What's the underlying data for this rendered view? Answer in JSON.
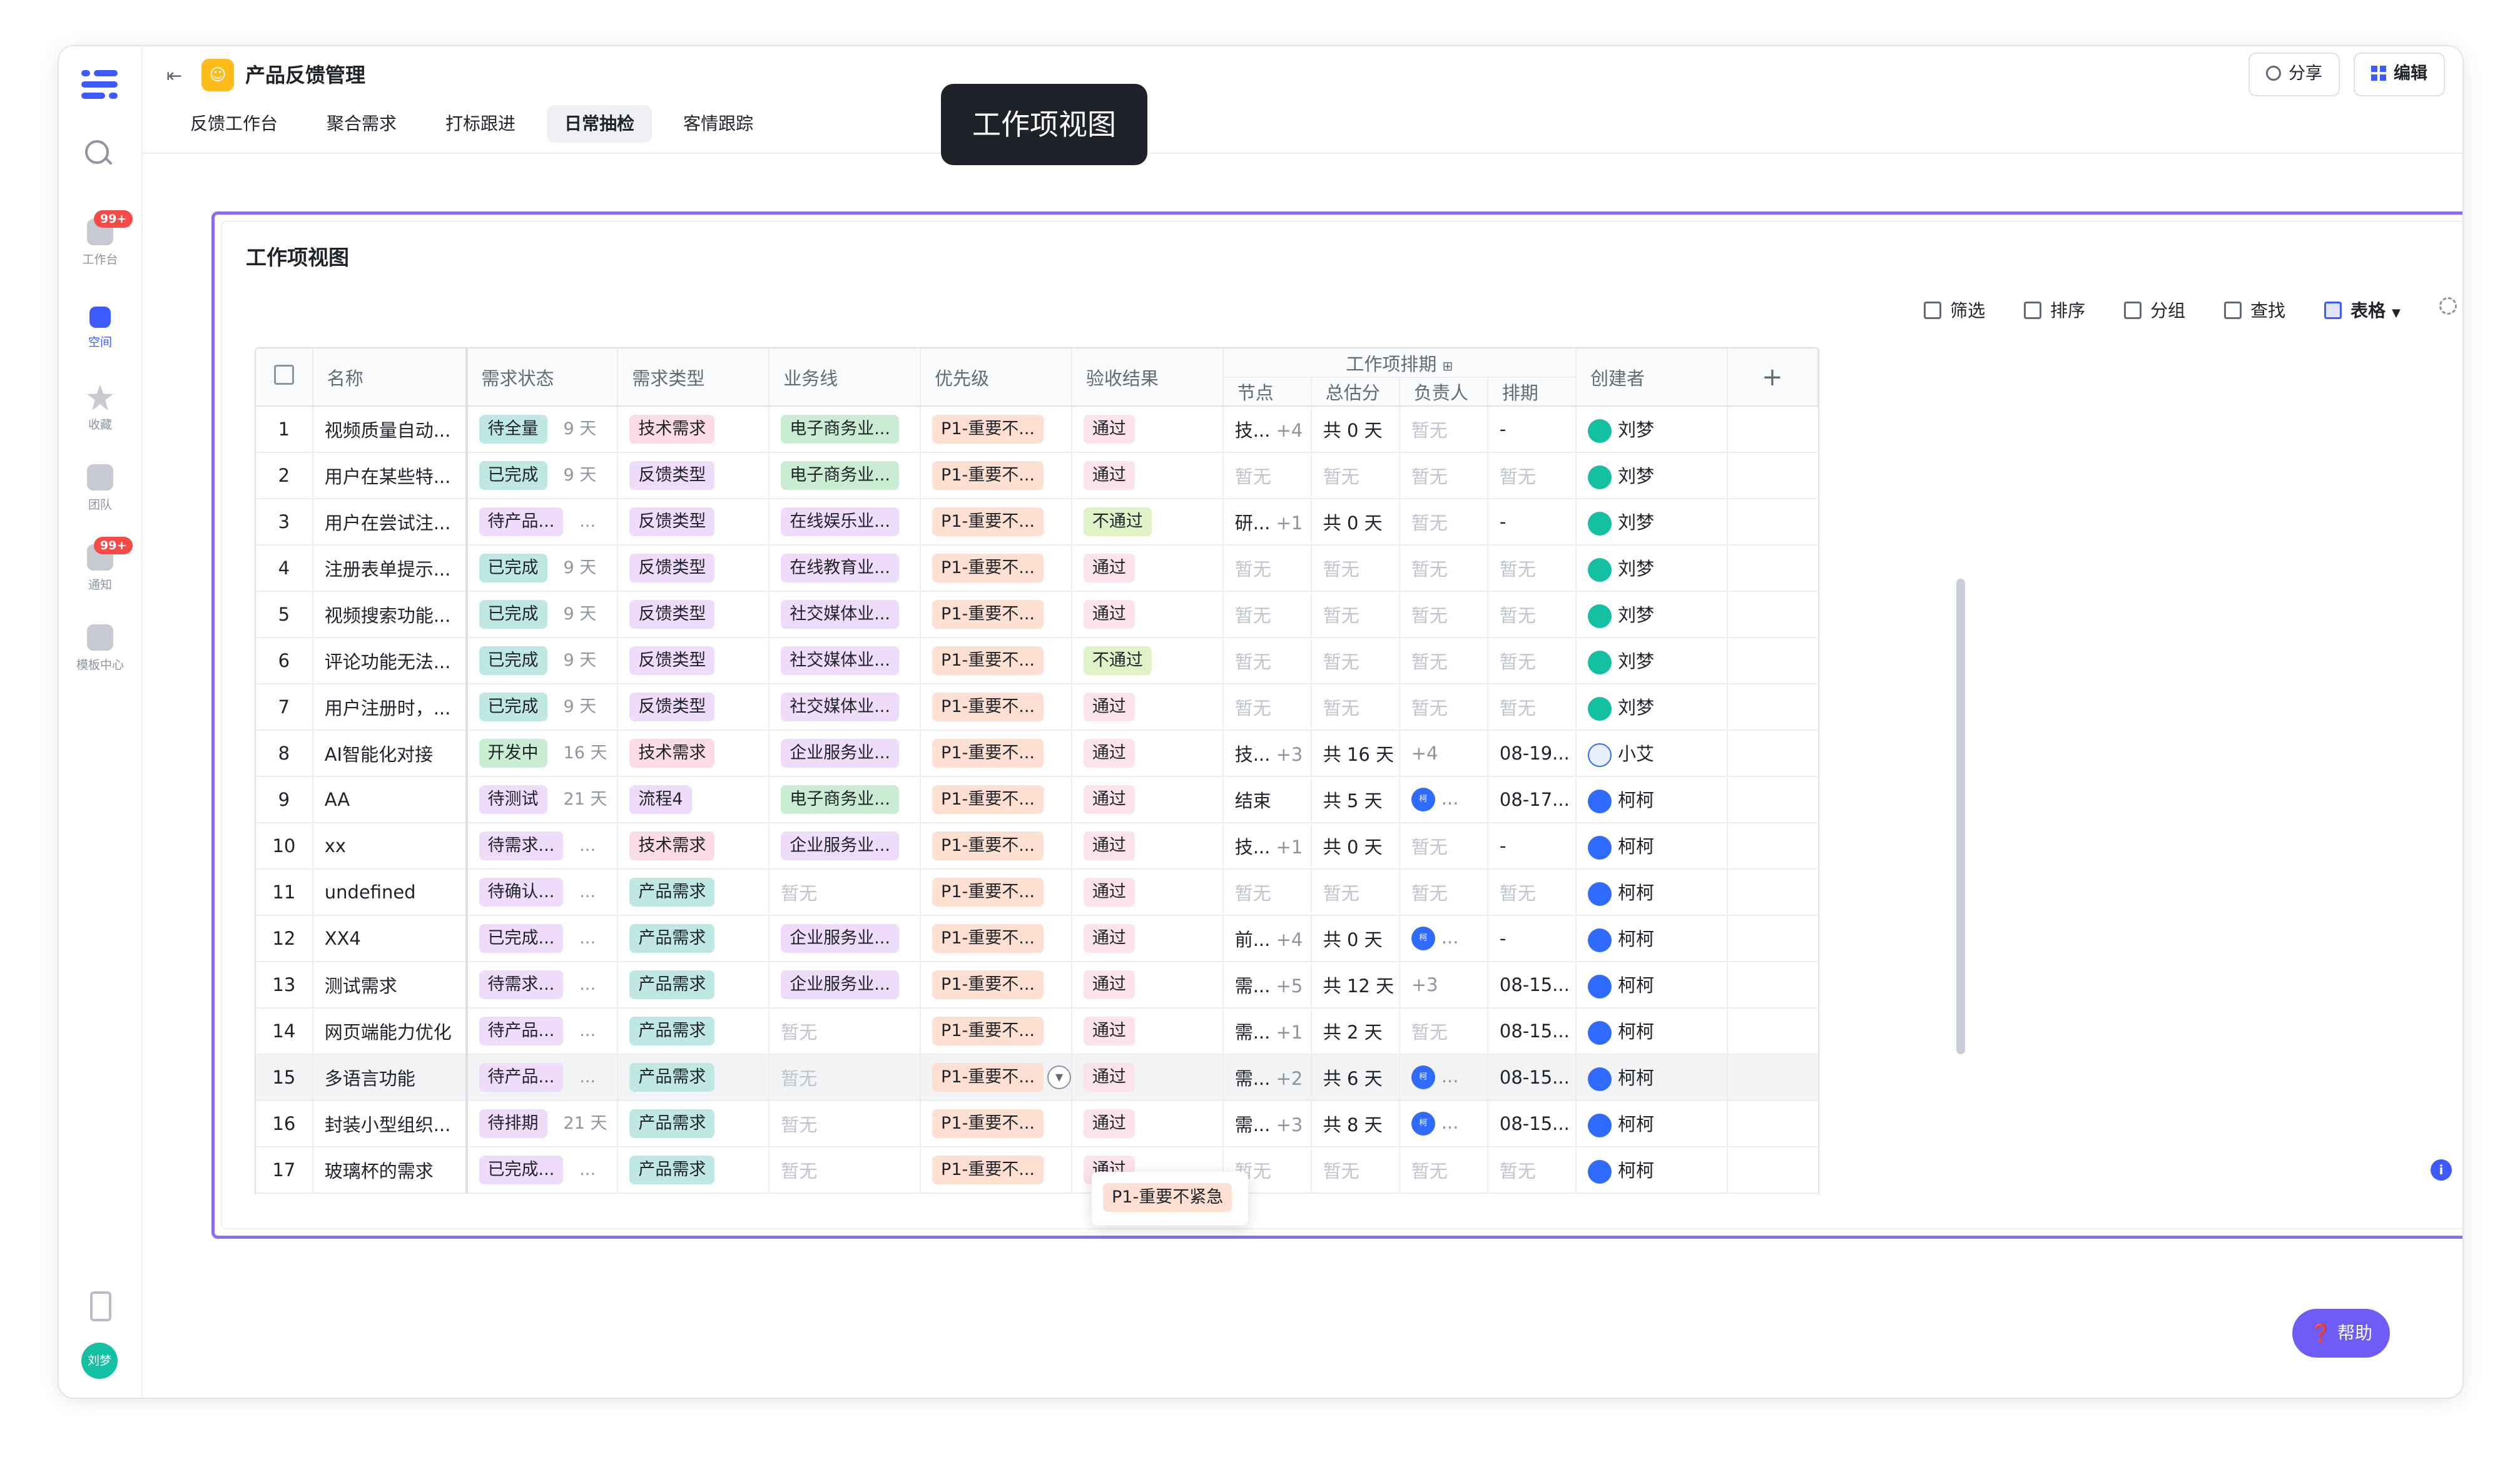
{
  "sidebar": {
    "items": [
      "工作台",
      "空间",
      "收藏",
      "团队",
      "通知",
      "模板中心"
    ],
    "badges": [
      "99+",
      "99+"
    ],
    "user_avatar": "刘梦"
  },
  "header": {
    "app_title": "产品反馈管理",
    "tabs": [
      "反馈工作台",
      "聚合需求",
      "打标跟进",
      "日常抽检",
      "客情跟踪"
    ],
    "share_label": "分享",
    "edit_label": "编辑",
    "accent_color": "#3d5afe"
  },
  "tooltip": "工作项视图",
  "view": {
    "title": "工作项视图",
    "toolbar": [
      "筛选",
      "排序",
      "分组",
      "查找",
      "表格"
    ]
  },
  "table": {
    "headers": [
      "名称",
      "需求状态",
      "需求类型",
      "业务线",
      "优先级",
      "验收结果",
      "工作项排期",
      "创建者"
    ],
    "sub_headers": [
      "节点",
      "总估分",
      "负责人",
      "排期"
    ],
    "rows": [
      {
        "num": "1",
        "name": "视频质量自动...",
        "status": "待全量",
        "dur": "9 天",
        "type": "技术需求",
        "biz": "电子商务业...",
        "prio": "P1-重要不...",
        "result": "通过",
        "node": "技...",
        "node_more": "+4",
        "est": "共 0 天",
        "owner": "暂无",
        "owner_more": "",
        "sched": "-",
        "creator": "刘梦"
      },
      {
        "num": "2",
        "name": "用户在某些特...",
        "status": "已完成",
        "dur": "9 天",
        "type": "反馈类型",
        "biz": "电子商务业...",
        "prio": "P1-重要不...",
        "result": "通过",
        "node": "暂无",
        "node_more": "",
        "est": "暂无",
        "owner": "暂无",
        "owner_more": "",
        "sched": "暂无",
        "creator": "刘梦"
      },
      {
        "num": "3",
        "name": "用户在尝试注...",
        "status": "待产品...",
        "dur": "...",
        "type": "反馈类型",
        "biz": "在线娱乐业...",
        "prio": "P1-重要不...",
        "result": "不通过",
        "node": "研...",
        "node_more": "+1",
        "est": "共 0 天",
        "owner": "暂无",
        "owner_more": "",
        "sched": "-",
        "creator": "刘梦"
      },
      {
        "num": "4",
        "name": "注册表单提示...",
        "status": "已完成",
        "dur": "9 天",
        "type": "反馈类型",
        "biz": "在线教育业...",
        "prio": "P1-重要不...",
        "result": "通过",
        "node": "暂无",
        "node_more": "",
        "est": "暂无",
        "owner": "暂无",
        "owner_more": "",
        "sched": "暂无",
        "creator": "刘梦"
      },
      {
        "num": "5",
        "name": "视频搜索功能...",
        "status": "已完成",
        "dur": "9 天",
        "type": "反馈类型",
        "biz": "社交媒体业...",
        "prio": "P1-重要不...",
        "result": "通过",
        "node": "暂无",
        "node_more": "",
        "est": "暂无",
        "owner": "暂无",
        "owner_more": "",
        "sched": "暂无",
        "creator": "刘梦"
      },
      {
        "num": "6",
        "name": "评论功能无法...",
        "status": "已完成",
        "dur": "9 天",
        "type": "反馈类型",
        "biz": "社交媒体业...",
        "prio": "P1-重要不...",
        "result": "不通过",
        "node": "暂无",
        "node_more": "",
        "est": "暂无",
        "owner": "暂无",
        "owner_more": "",
        "sched": "暂无",
        "creator": "刘梦"
      },
      {
        "num": "7",
        "name": "用户注册时，...",
        "status": "已完成",
        "dur": "9 天",
        "type": "反馈类型",
        "biz": "社交媒体业...",
        "prio": "P1-重要不...",
        "result": "通过",
        "node": "暂无",
        "node_more": "",
        "est": "暂无",
        "owner": "暂无",
        "owner_more": "",
        "sched": "暂无",
        "creator": "刘梦"
      },
      {
        "num": "8",
        "name": "AI智能化对接",
        "status": "开发中",
        "dur": "16 天",
        "type": "技术需求",
        "biz": "企业服务业...",
        "prio": "P1-重要不...",
        "result": "通过",
        "node": "技...",
        "node_more": "+3",
        "est": "共 16 天",
        "owner": "+4",
        "owner_more": "",
        "sched": "08-19...",
        "creator": "小艾"
      },
      {
        "num": "9",
        "name": "AA",
        "status": "待测试",
        "dur": "21 天",
        "type": "流程4",
        "biz": "电子商务业...",
        "prio": "P1-重要不...",
        "result": "通过",
        "node": "结束",
        "node_more": "",
        "est": "共 5 天",
        "owner": "...",
        "owner_more": "",
        "sched": "08-17...",
        "creator": "柯柯"
      },
      {
        "num": "10",
        "name": "xx",
        "status": "待需求...",
        "dur": "...",
        "type": "技术需求",
        "biz": "企业服务业...",
        "prio": "P1-重要不...",
        "result": "通过",
        "node": "技...",
        "node_more": "+1",
        "est": "共 0 天",
        "owner": "暂无",
        "owner_more": "",
        "sched": "-",
        "creator": "柯柯"
      },
      {
        "num": "11",
        "name": "undefined",
        "status": "待确认...",
        "dur": "...",
        "type": "产品需求",
        "biz": "暂无",
        "prio": "P1-重要不...",
        "result": "通过",
        "node": "暂无",
        "node_more": "",
        "est": "暂无",
        "owner": "暂无",
        "owner_more": "",
        "sched": "暂无",
        "creator": "柯柯"
      },
      {
        "num": "12",
        "name": "XX4",
        "status": "已完成...",
        "dur": "...",
        "type": "产品需求",
        "biz": "企业服务业...",
        "prio": "P1-重要不...",
        "result": "通过",
        "node": "前...",
        "node_more": "+4",
        "est": "共 0 天",
        "owner": "...",
        "owner_more": "",
        "sched": "-",
        "creator": "柯柯"
      },
      {
        "num": "13",
        "name": "测试需求",
        "status": "待需求...",
        "dur": "...",
        "type": "产品需求",
        "biz": "企业服务业...",
        "prio": "P1-重要不...",
        "result": "通过",
        "node": "需...",
        "node_more": "+5",
        "est": "共 12 天",
        "owner": "+3",
        "owner_more": "",
        "sched": "08-15...",
        "creator": "柯柯"
      },
      {
        "num": "14",
        "name": "网页端能力优化",
        "status": "待产品...",
        "dur": "...",
        "type": "产品需求",
        "biz": "暂无",
        "prio": "P1-重要不...",
        "result": "通过",
        "node": "需...",
        "node_more": "+1",
        "est": "共 2 天",
        "owner": "暂无",
        "owner_more": "",
        "sched": "08-15...",
        "creator": "柯柯"
      },
      {
        "num": "15",
        "name": "多语言功能",
        "status": "待产品...",
        "dur": "...",
        "type": "产品需求",
        "biz": "暂无",
        "prio": "P1-重要不...",
        "result": "通过",
        "node": "需...",
        "node_more": "+2",
        "est": "共 6 天",
        "owner": "...",
        "owner_more": "",
        "sched": "08-15...",
        "creator": "柯柯"
      },
      {
        "num": "16",
        "name": "封装小型组织...",
        "status": "待排期",
        "dur": "21 天",
        "type": "产品需求",
        "biz": "暂无",
        "prio": "P1-重要不...",
        "result": "通过",
        "node": "需...",
        "node_more": "+3",
        "est": "共 8 天",
        "owner": "...",
        "owner_more": "",
        "sched": "08-15...",
        "creator": "柯柯"
      },
      {
        "num": "17",
        "name": "玻璃杯的需求",
        "status": "已完成...",
        "dur": "...",
        "type": "产品需求",
        "biz": "暂无",
        "prio": "P1-重要不...",
        "result": "通过",
        "node": "暂无",
        "node_more": "",
        "est": "暂无",
        "owner": "暂无",
        "owner_more": "",
        "sched": "暂无",
        "creator": "柯柯"
      }
    ],
    "priority_popup": "P1-重要不紧急"
  },
  "help_label": "帮助",
  "info_icon": "info-icon"
}
